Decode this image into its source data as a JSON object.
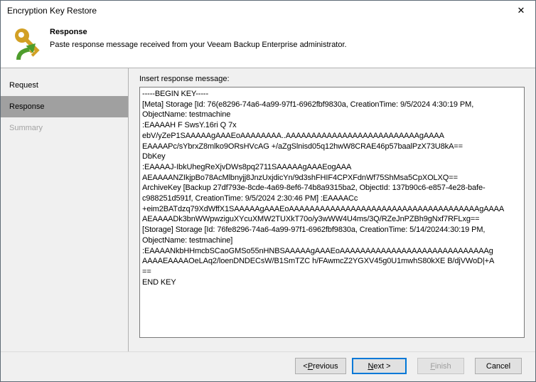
{
  "window": {
    "title": "Encryption Key Restore",
    "close_glyph": "✕"
  },
  "header": {
    "title": "Response",
    "subtitle": "Paste response message received from your Veeam Backup Enterprise administrator."
  },
  "sidebar": {
    "items": [
      {
        "label": "Request",
        "state": "normal"
      },
      {
        "label": "Response",
        "state": "active"
      },
      {
        "label": "Summary",
        "state": "disabled"
      }
    ]
  },
  "main": {
    "label": "Insert response message:",
    "message_lines": [
      "-----BEGIN KEY-----",
      "[Meta] Storage [Id: 76(e8296-74a6-4a99-97f1-6962fbf9830a, CreationTime: 9/5/2024 4:30:19 PM,",
      "ObjectName: testmachine",
      ":EAAAAH F SwsY.16ri Q 7x",
      "ebV/yZeP1SAAAAAgAAAEoAAAAAAAA..AAAAAAAAAAAAAAAAAAAAAAAAAAgAAAA",
      "EAAAAPc/sYbrxZ8mlko9ORsHVcAG +/aZgSlnisd05q12hwW8CRAE46p57baalPzX73U8kA==",
      "DbKey",
      ":EAAAAJ-IbkUhegReXjvDWs8pq2711SAAAAAgAAAEogAAA",
      "AEAAAANZIkjpBo78AcMlbnyjj8JnzUxjdicYn/9d3shFHIF4CPXFdnWf75ShMsa5CpXOLXQ==",
      "ArchiveKey [Backup 27df793e-8cde-4a69-8ef6-74b8a9315ba2, ObjectId: 137b90c6-e857-4e28-bafe-",
      "c988251d591f, CreationTime: 9/5/2024 2:30:46 PM] :EAAAACc",
      "+eim2BATdzq79XdWffX1SAAAAAgAAAEoAAAAAAAAAAAAAAAAAAAAAAAAAAAAAAAAAAAAAgAAAA",
      "AEAAAADk3bnWWpwziguXYcuXMW2TUXkT70o/y3wWW4U4ms/3Q/RZeJnPZBh9gNxf7RFLxg==",
      "[Storage] Storage [Id: 76fe8296-74a6-4a99-97f1-6962fbf9830a, CreationTime: 5/14/20244:30:19 PM,",
      "ObjectName: testmachine]",
      ":EAAAANkbHHmcbSCaoGMSo55nHNBSAAAAAgAAAEoAAAAAAAAAAAAAAAAAAAAAAAAAAAAAg",
      "AAAAEAAAAOeLAq2/loenDNDECsW/B1SmTZC h/FAwmcZ2YGXV45g0U1mwhS80kXE B/djVWoD|+A",
      "==",
      "END KEY"
    ]
  },
  "footer": {
    "previous": {
      "pre": "< ",
      "accel": "P",
      "post": "revious"
    },
    "next": {
      "pre": "",
      "accel": "N",
      "post": "ext >"
    },
    "finish": {
      "pre": "",
      "accel": "F",
      "post": "inish"
    },
    "cancel": {
      "pre": "",
      "accel": "",
      "post": "Cancel"
    }
  },
  "colors": {
    "focus_accent": "#0078d7",
    "active_step_bg": "#a0a0a0",
    "key_gold": "#d2a024",
    "arrow_green": "#4e9d2d"
  }
}
